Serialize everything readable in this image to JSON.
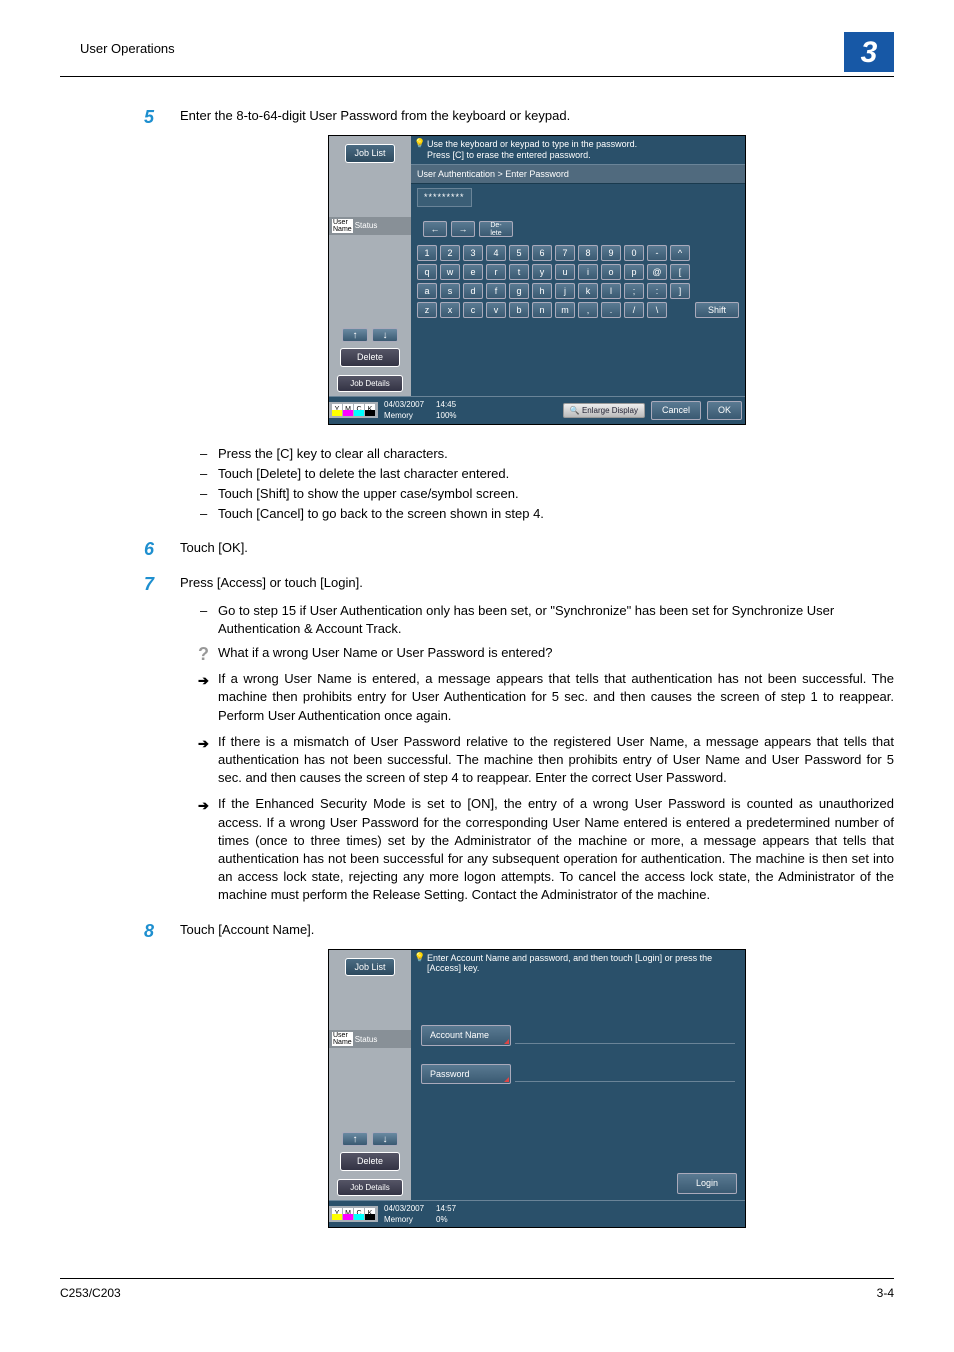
{
  "header": {
    "section": "User Operations",
    "chapter": "3"
  },
  "footer": {
    "model": "C253/C203",
    "page": "3-4"
  },
  "step5": {
    "num": "5",
    "text": "Enter the 8-to-64-digit User Password from the keyboard or keypad.",
    "notes": [
      "Press the [C] key to clear all characters.",
      "Touch [Delete] to delete the last character entered.",
      "Touch [Shift] to show the upper case/symbol screen.",
      "Touch [Cancel] to go back to the screen shown in step 4."
    ]
  },
  "step6": {
    "num": "6",
    "text": "Touch [OK]."
  },
  "step7": {
    "num": "7",
    "text": "Press [Access] or touch [Login].",
    "dash": "Go to step 15 if User Authentication only has been set, or \"Synchronize\" has been set for Synchronize User Authentication & Account Track.",
    "question": "What if a wrong User Name or User Password is entered?",
    "arrows": [
      "If a wrong User Name is entered, a message appears that tells that authentication has not been successful. The machine then prohibits entry for User Authentication for 5 sec. and then causes the screen of step 1 to reappear. Perform User Authentication once again.",
      "If there is a mismatch of User Password relative to the registered User Name, a message appears that tells that authentication has not been successful. The machine then prohibits entry of User Name and User Password for 5 sec. and then causes the screen of step 4 to reappear. Enter the correct User Password.",
      "If the Enhanced Security Mode is set to [ON], the entry of a wrong User Password is counted as unauthorized access. If a wrong User Password for the corresponding User Name entered is entered a predetermined number of times (once to three times) set by the Administrator of the machine or more, a message appears that tells that authentication has not been successful for any subsequent operation for authentication. The machine is then set into an access lock state, rejecting any more logon attempts. To cancel the access lock state, the Administrator of the machine must perform the Release Setting. Contact the Administrator of the machine."
    ]
  },
  "step8": {
    "num": "8",
    "text": "Touch [Account Name]."
  },
  "panel1": {
    "joblist": "Job List",
    "userstatus_user": "User\nName",
    "status": "Status",
    "msg": "Use the keyboard or keypad to type in the password.\nPress [C] to erase the entered password.",
    "breadcrumb": "User Authentication > Enter Password",
    "pw_value": "*********",
    "nav_left": "←",
    "nav_right": "→",
    "nav_delete": "De-\nlete",
    "row1": [
      "1",
      "2",
      "3",
      "4",
      "5",
      "6",
      "7",
      "8",
      "9",
      "0",
      "-",
      "^"
    ],
    "row2": [
      "q",
      "w",
      "e",
      "r",
      "t",
      "y",
      "u",
      "i",
      "o",
      "p",
      "@",
      "["
    ],
    "row3": [
      "a",
      "s",
      "d",
      "f",
      "g",
      "h",
      "j",
      "k",
      "l",
      ";",
      ":",
      "]"
    ],
    "row4": [
      "z",
      "x",
      "c",
      "v",
      "b",
      "n",
      "m",
      ",",
      ".",
      "/",
      "\\"
    ],
    "shift": "Shift",
    "up": "↑",
    "down": "↓",
    "delete_btn": "Delete",
    "jobdetails": "Job Details",
    "date": "04/03/2007",
    "time": "14:45",
    "memory": "Memory",
    "memval": "100%",
    "enlarge": "Enlarge Display",
    "cancel": "Cancel",
    "ok": "OK",
    "toners": [
      "Y",
      "M",
      "C",
      "K"
    ]
  },
  "panel2": {
    "joblist": "Job List",
    "status": "Status",
    "msg": "Enter Account Name and password, and then touch [Login] or press the [Access] key.",
    "account_name": "Account Name",
    "password": "Password",
    "up": "↑",
    "down": "↓",
    "delete_btn": "Delete",
    "jobdetails": "Job Details",
    "login": "Login",
    "date": "04/03/2007",
    "time": "14:57",
    "memory": "Memory",
    "memval": "0%",
    "toners": [
      "Y",
      "M",
      "C",
      "K"
    ]
  }
}
